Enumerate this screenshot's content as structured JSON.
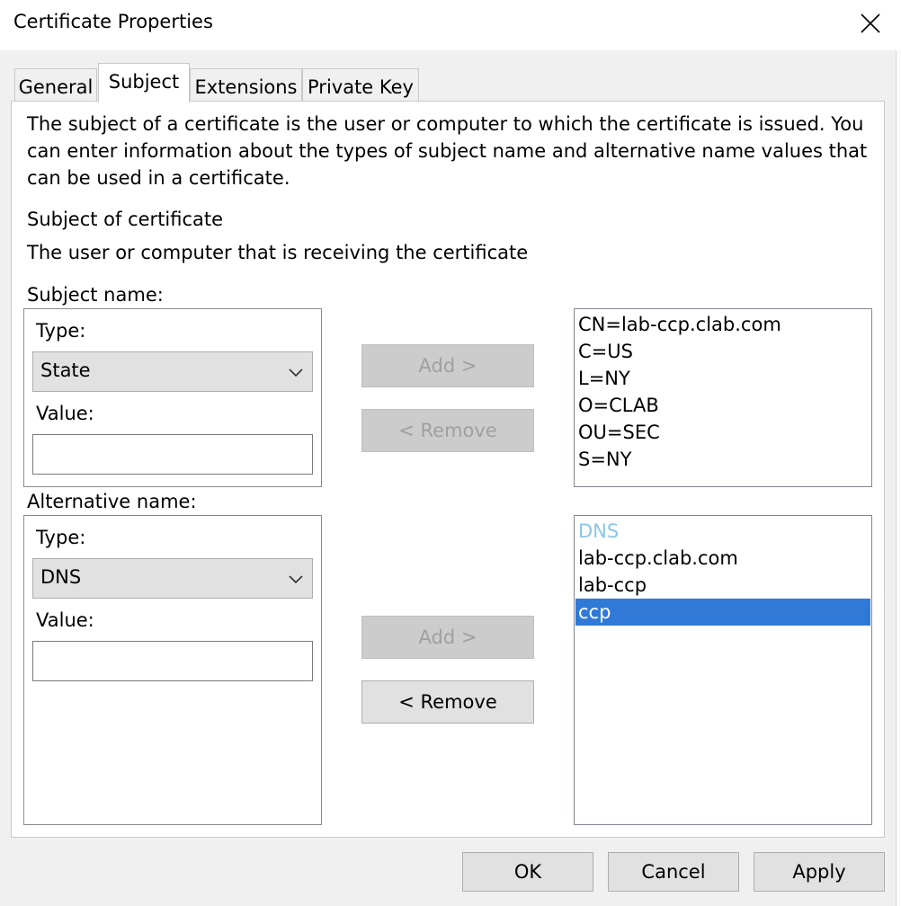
{
  "window": {
    "title": "Certificate Properties"
  },
  "tabs": [
    {
      "label": "General",
      "active": false
    },
    {
      "label": "Subject",
      "active": true
    },
    {
      "label": "Extensions",
      "active": false
    },
    {
      "label": "Private Key",
      "active": false
    }
  ],
  "panel": {
    "description_lines": [
      "The subject of a certificate is the user or computer to which the certificate is issued. You",
      "can enter information about the types of subject name and alternative name values that",
      "can be used in a certificate."
    ],
    "subject_heading": "Subject of certificate",
    "subject_subheading": "The user or computer that is receiving the certificate"
  },
  "subject_name": {
    "label": "Subject name:",
    "type_label": "Type:",
    "type_value": "State",
    "value_label": "Value:",
    "value": "",
    "add_label": "Add >",
    "remove_label": "< Remove",
    "entries": [
      "CN=lab-ccp.clab.com",
      "C=US",
      "L=NY",
      "O=CLAB",
      "OU=SEC",
      "S=NY"
    ]
  },
  "alternative_name": {
    "label": "Alternative name:",
    "type_label": "Type:",
    "type_value": "DNS",
    "value_label": "Value:",
    "value": "",
    "add_label": "Add >",
    "remove_label": "< Remove",
    "group_header": "DNS",
    "entries": [
      "lab-ccp.clab.com",
      "lab-ccp",
      "ccp"
    ],
    "selected_entry": "ccp"
  },
  "footer": {
    "ok_label": "OK",
    "cancel_label": "Cancel",
    "apply_label": "Apply"
  },
  "colors": {
    "selection": "#3079d6",
    "group_header": "#8ac6e8",
    "dialog_bg": "#f0f0f0"
  }
}
